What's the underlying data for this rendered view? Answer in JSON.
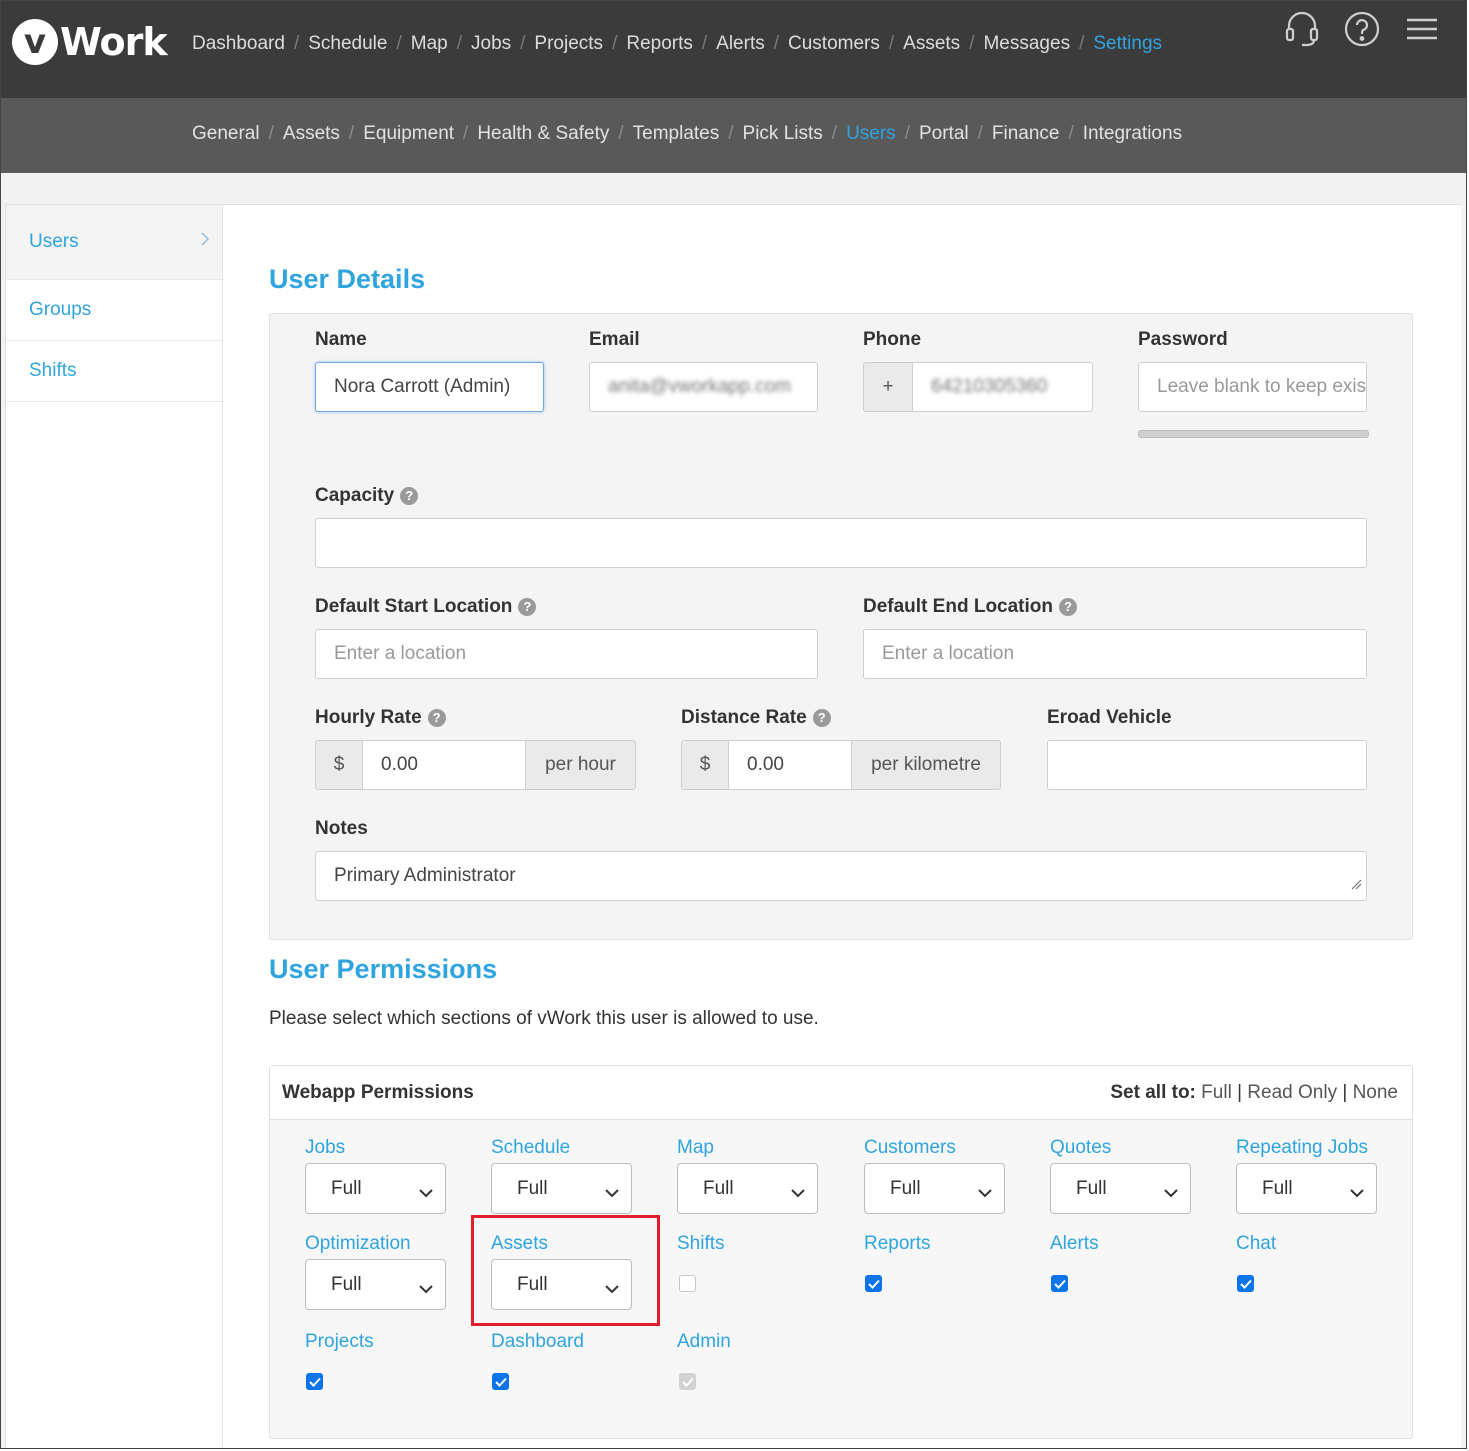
{
  "logo": {
    "mark": "v",
    "text": "Work"
  },
  "main_nav": [
    {
      "label": "Dashboard",
      "active": false
    },
    {
      "label": "Schedule",
      "active": false
    },
    {
      "label": "Map",
      "active": false
    },
    {
      "label": "Jobs",
      "active": false
    },
    {
      "label": "Projects",
      "active": false
    },
    {
      "label": "Reports",
      "active": false
    },
    {
      "label": "Alerts",
      "active": false
    },
    {
      "label": "Customers",
      "active": false
    },
    {
      "label": "Assets",
      "active": false
    },
    {
      "label": "Messages",
      "active": false
    },
    {
      "label": "Settings",
      "active": true
    }
  ],
  "nav_separator": "/",
  "top_icons": [
    "headset-icon",
    "help-icon",
    "menu-icon"
  ],
  "settings_nav": [
    {
      "label": "General",
      "active": false
    },
    {
      "label": "Assets",
      "active": false
    },
    {
      "label": "Equipment",
      "active": false
    },
    {
      "label": "Health & Safety",
      "active": false
    },
    {
      "label": "Templates",
      "active": false
    },
    {
      "label": "Pick Lists",
      "active": false
    },
    {
      "label": "Users",
      "active": true
    },
    {
      "label": "Portal",
      "active": false
    },
    {
      "label": "Finance",
      "active": false
    },
    {
      "label": "Integrations",
      "active": false
    }
  ],
  "sidebar": {
    "items": [
      {
        "label": "Users",
        "active": true
      },
      {
        "label": "Groups",
        "active": false
      },
      {
        "label": "Shifts",
        "active": false
      }
    ]
  },
  "user_details": {
    "title": "User Details",
    "name_label": "Name",
    "name_value": "Nora Carrott (Admin)",
    "email_label": "Email",
    "email_value": "anita@vworkapp.com",
    "phone_label": "Phone",
    "phone_prefix": "+",
    "phone_value": "64210305360",
    "password_label": "Password",
    "password_placeholder": "Leave blank to keep existing",
    "capacity_label": "Capacity",
    "capacity_value": "",
    "start_location_label": "Default Start Location",
    "start_location_placeholder": "Enter a location",
    "end_location_label": "Default End Location",
    "end_location_placeholder": "Enter a location",
    "hourly_rate_label": "Hourly Rate",
    "hourly_currency": "$",
    "hourly_value": "0.00",
    "hourly_unit": "per hour",
    "distance_rate_label": "Distance Rate",
    "distance_currency": "$",
    "distance_value": "0.00",
    "distance_unit": "per kilometre",
    "eroad_label": "Eroad Vehicle",
    "eroad_value": "",
    "notes_label": "Notes",
    "notes_value": "Primary Administrator"
  },
  "user_permissions": {
    "title": "User Permissions",
    "intro": "Please select which sections of vWork this user is allowed to use.",
    "panel_title": "Webapp Permissions",
    "set_all_label": "Set all to:",
    "set_all_full": "Full",
    "set_all_readonly": "Read Only",
    "set_all_none": "None",
    "set_all_sep": "|",
    "selects": [
      {
        "label": "Jobs",
        "value": "Full"
      },
      {
        "label": "Schedule",
        "value": "Full"
      },
      {
        "label": "Map",
        "value": "Full"
      },
      {
        "label": "Customers",
        "value": "Full"
      },
      {
        "label": "Quotes",
        "value": "Full"
      },
      {
        "label": "Repeating Jobs",
        "value": "Full"
      },
      {
        "label": "Optimization",
        "value": "Full"
      },
      {
        "label": "Assets",
        "value": "Full"
      }
    ],
    "checkboxes": [
      {
        "label": "Shifts",
        "checked": false,
        "disabled": false
      },
      {
        "label": "Reports",
        "checked": true,
        "disabled": false
      },
      {
        "label": "Alerts",
        "checked": true,
        "disabled": false
      },
      {
        "label": "Chat",
        "checked": true,
        "disabled": false
      },
      {
        "label": "Projects",
        "checked": true,
        "disabled": false
      },
      {
        "label": "Dashboard",
        "checked": true,
        "disabled": false
      },
      {
        "label": "Admin",
        "checked": true,
        "disabled": true
      }
    ]
  },
  "colors": {
    "accent": "#2fa4de",
    "topbar": "#3b3b3b",
    "subbar": "#595959",
    "checkbox": "#0a74e8",
    "highlight": "#e01e2c"
  }
}
